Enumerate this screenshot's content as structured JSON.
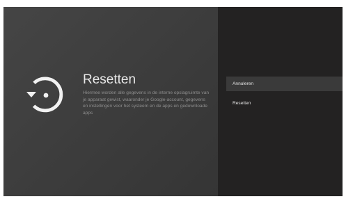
{
  "dialog": {
    "title": "Resetten",
    "description": "Hiermee worden alle gegevens in de interne opslagruimte van je apparaat gewist, waaronder je Google-account, gegevens en instellingen voor het systeem en de apps en gedownloade apps",
    "icon": "reset-icon"
  },
  "options": [
    {
      "label": "Annuleren",
      "selected": true
    },
    {
      "label": "Resetten",
      "selected": false
    }
  ],
  "colors": {
    "panel_bg": "#3f3f3f",
    "side_bg": "#232222",
    "selected_bg": "#3a3a3a",
    "title_text": "#e8e8e8",
    "body_text": "#8e8e8e"
  }
}
